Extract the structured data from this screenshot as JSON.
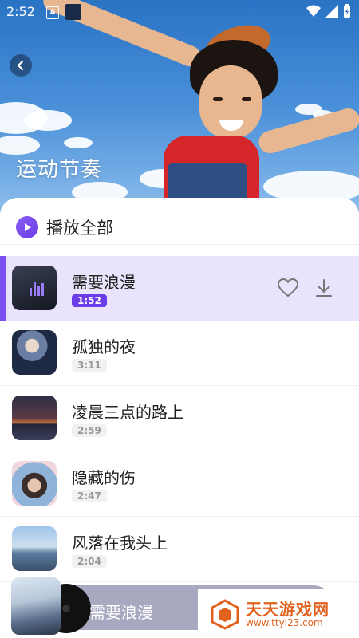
{
  "status_bar": {
    "time": "2:52",
    "badge": "A"
  },
  "header": {
    "title": "运动节奏"
  },
  "play_all": {
    "label": "播放全部"
  },
  "songs": [
    {
      "title": "需要浪漫",
      "duration": "1:52",
      "active": true
    },
    {
      "title": "孤独的夜",
      "duration": "3:11",
      "active": false
    },
    {
      "title": "凌晨三点的路上",
      "duration": "2:59",
      "active": false
    },
    {
      "title": "隐藏的伤",
      "duration": "2:47",
      "active": false
    },
    {
      "title": "风落在我头上",
      "duration": "2:04",
      "active": false
    }
  ],
  "mini_player": {
    "title": "需要浪漫"
  },
  "watermark": {
    "name": "天天游戏网",
    "url": "www.ttyl23.com"
  },
  "colors": {
    "accent": "#6a3de8",
    "active_row": "#e9e4fb"
  }
}
